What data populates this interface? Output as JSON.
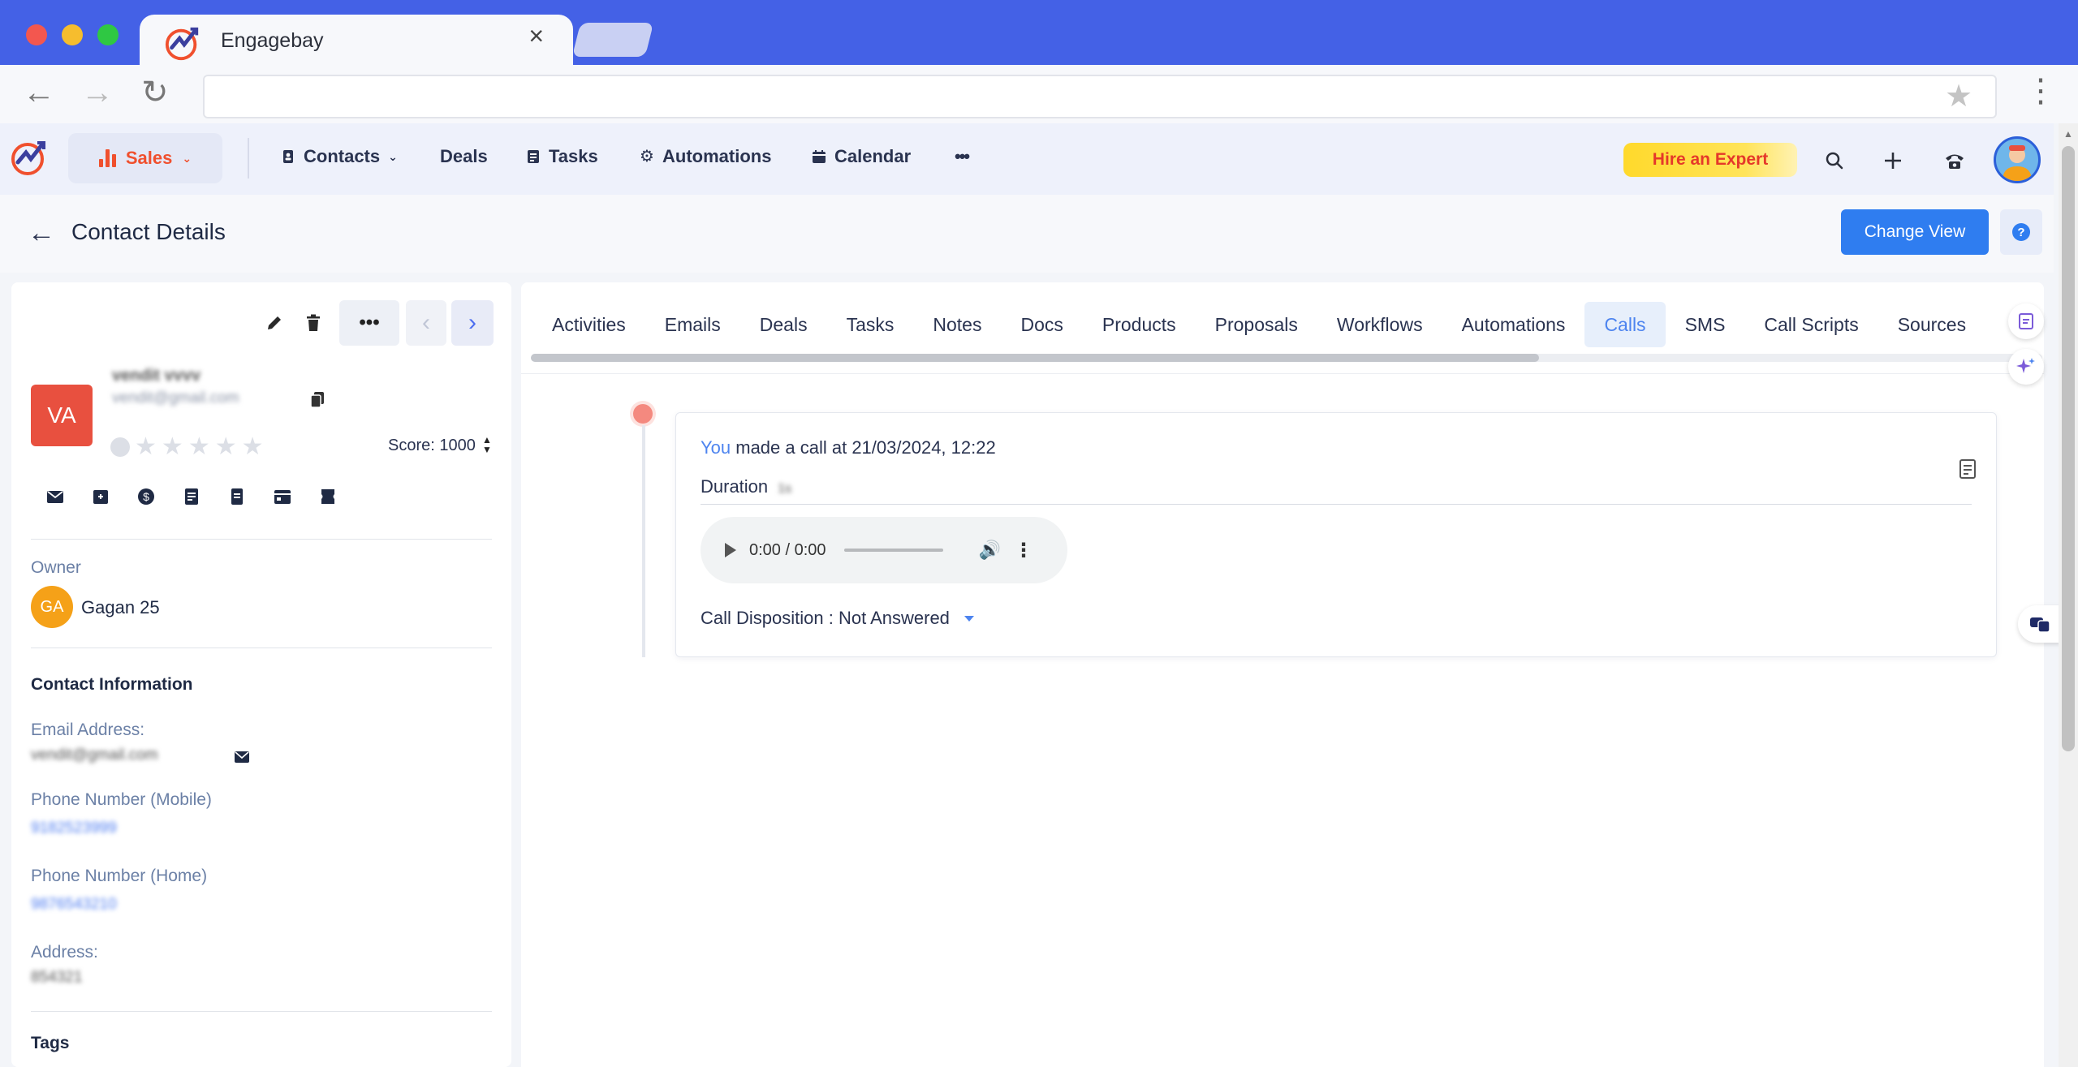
{
  "browser": {
    "tab_title": "Engagebay",
    "tab_close": "×",
    "url": ""
  },
  "app": {
    "module": "Sales",
    "menu": [
      {
        "label": "Contacts",
        "icon": "contact-book-icon",
        "has_dropdown": true
      },
      {
        "label": "Deals",
        "icon": "",
        "has_dropdown": false
      },
      {
        "label": "Tasks",
        "icon": "tasks-icon",
        "has_dropdown": false
      },
      {
        "label": "Automations",
        "icon": "gear-icon",
        "has_dropdown": false
      },
      {
        "label": "Calendar",
        "icon": "calendar-icon",
        "has_dropdown": false
      }
    ],
    "more": "•••",
    "hire_expert": "Hire an Expert"
  },
  "page": {
    "title": "Contact Details",
    "change_view": "Change View",
    "help": "?"
  },
  "contact": {
    "initials": "VA",
    "name": "vendit vvvv",
    "email": "vendit@gmail.com",
    "score_label": "Score: 1000",
    "rating": 0,
    "owner_label": "Owner",
    "owner_initials": "GA",
    "owner_name": "Gagan 25",
    "info_title": "Contact Information",
    "email_label": "Email Address:",
    "email_value": "vendit@gmail.com",
    "mobile_label": "Phone Number (Mobile)",
    "mobile_value": "9182523999",
    "home_label": "Phone Number (Home)",
    "home_value": "9876543210",
    "address_label": "Address:",
    "address_value": "854321",
    "tags_title": "Tags"
  },
  "tabs": [
    "Activities",
    "Emails",
    "Deals",
    "Tasks",
    "Notes",
    "Docs",
    "Products",
    "Proposals",
    "Workflows",
    "Automations",
    "Calls",
    "SMS",
    "Call Scripts",
    "Sources"
  ],
  "active_tab": "Calls",
  "call": {
    "actor": "You",
    "text": "made a call at 21/03/2024, 12:22",
    "duration_label": "Duration",
    "duration_value": "1s",
    "audio_time": "0:00 / 0:00",
    "disposition": "Call Disposition : Not Answered"
  },
  "colors": {
    "accent": "#4461e6",
    "primary_button": "#2f7df0",
    "sales": "#f0502e",
    "avatar_va": "#e8503f",
    "avatar_ga": "#f5a118"
  }
}
